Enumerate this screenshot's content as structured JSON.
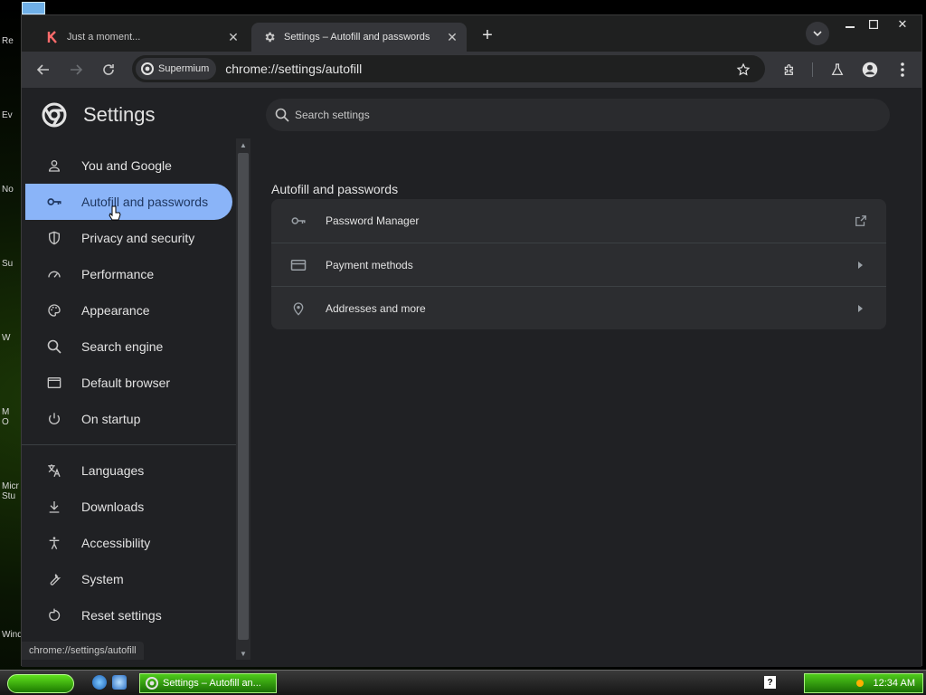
{
  "desktop": {
    "labels": [
      "Re",
      "Ev",
      "No",
      "Su",
      "W",
      "M\nO",
      "Micr\nStu",
      "Wind"
    ]
  },
  "tabs": [
    {
      "title": "Just a moment...",
      "icon": "k-favicon"
    },
    {
      "title": "Settings – Autofill and passwords",
      "icon": "gear-icon"
    }
  ],
  "toolbar": {
    "chip_label": "Supermium",
    "url": "chrome://settings/autofill"
  },
  "settings": {
    "title": "Settings",
    "search_placeholder": "Search settings",
    "nav_primary": [
      {
        "label": "You and Google",
        "icon": "person-icon"
      },
      {
        "label": "Autofill and passwords",
        "icon": "key-icon"
      },
      {
        "label": "Privacy and security",
        "icon": "shield-icon"
      },
      {
        "label": "Performance",
        "icon": "speedometer-icon"
      },
      {
        "label": "Appearance",
        "icon": "palette-icon"
      },
      {
        "label": "Search engine",
        "icon": "search-icon"
      },
      {
        "label": "Default browser",
        "icon": "browser-window-icon"
      },
      {
        "label": "On startup",
        "icon": "power-icon"
      }
    ],
    "nav_secondary": [
      {
        "label": "Languages",
        "icon": "translate-icon"
      },
      {
        "label": "Downloads",
        "icon": "download-icon"
      },
      {
        "label": "Accessibility",
        "icon": "accessibility-icon"
      },
      {
        "label": "System",
        "icon": "wrench-icon"
      },
      {
        "label": "Reset settings",
        "icon": "reset-icon"
      }
    ],
    "section_title": "Autofill and passwords",
    "rows": [
      {
        "label": "Password Manager",
        "icon": "key-icon",
        "end_icon": "external-link-icon"
      },
      {
        "label": "Payment methods",
        "icon": "credit-card-icon",
        "end_icon": "chevron-right-icon"
      },
      {
        "label": "Addresses and more",
        "icon": "location-pin-icon",
        "end_icon": "chevron-right-icon"
      }
    ],
    "status_url": "chrome://settings/autofill"
  },
  "taskbar": {
    "active_window": "Settings – Autofill an...",
    "help": "?",
    "clock": "12:34 AM"
  },
  "colors": {
    "accent": "#8ab4f8",
    "active_text": "#1f3760",
    "page_bg": "#202124",
    "card_bg": "#2c2d30",
    "xp_green": "#3fb514"
  }
}
